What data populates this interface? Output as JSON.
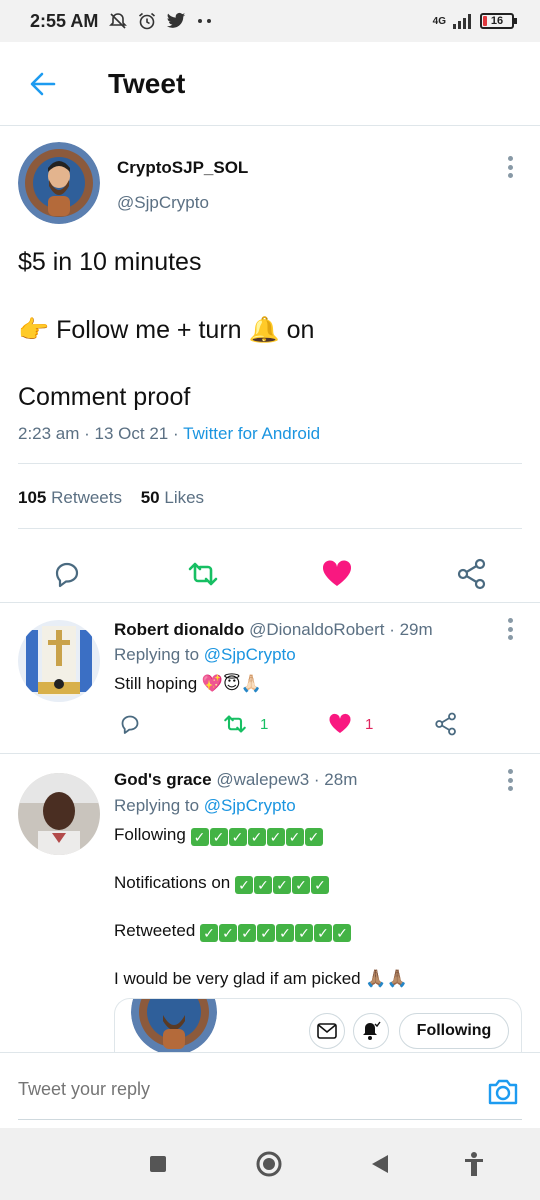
{
  "status_bar": {
    "time": "2:55 AM",
    "net": "4G",
    "battery": "16",
    "battery_level": 0.16,
    "icons": [
      "mute-bell-icon",
      "alarm-icon",
      "twitter-icon",
      "more-dots-icon",
      "signal-icon",
      "battery-icon"
    ]
  },
  "header": {
    "title": "Tweet",
    "back_icon": "back-arrow-icon"
  },
  "tweet": {
    "author_name": "CryptoSJP_SOL",
    "author_handle": "@SjpCrypto",
    "lines": [
      "$5 in 10 minutes",
      "👉 Follow me + turn 🔔 on",
      "Comment proof"
    ],
    "time": "2:23 am",
    "date": "13 Oct 21",
    "source": "Twitter for Android",
    "retweets_count": "105",
    "retweets_label": "Retweets",
    "likes_count": "50",
    "likes_label": "Likes"
  },
  "replies": [
    {
      "name": "Robert dionaldo",
      "handle": "@DionaldoRobert",
      "time": "· 29m",
      "replying_label": "Replying to",
      "replying_to": "@SjpCrypto",
      "text": "Still hoping 💖😇🙏🏻",
      "retweets": "1",
      "likes": "1"
    },
    {
      "name": "God's grace",
      "handle": "@walepew3",
      "time": "· 28m",
      "replying_label": "Replying to",
      "replying_to": "@SjpCrypto",
      "lines": [
        {
          "label": "Following",
          "checks": 7
        },
        {
          "label": "Notifications on",
          "checks": 5
        },
        {
          "label": "Retweeted",
          "checks": 8
        }
      ],
      "last_line": "I would be very glad if am picked 🙏🏽🙏🏽",
      "follow_label": "Following"
    }
  ],
  "reply_bar": {
    "placeholder": "Tweet your reply"
  },
  "colors": {
    "accent": "#1b95e0",
    "retweet_green": "#17bf63",
    "like_red": "#e0245e",
    "check_green": "#43b345"
  }
}
